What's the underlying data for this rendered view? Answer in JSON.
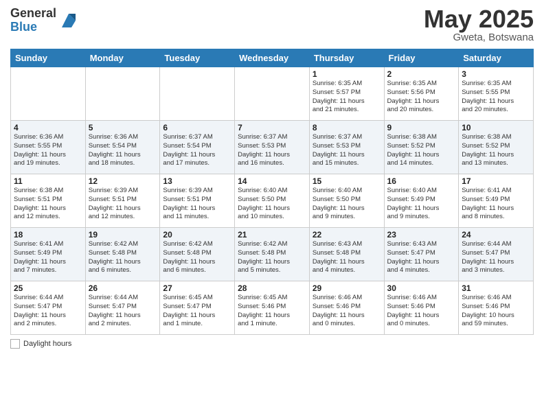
{
  "header": {
    "logo_general": "General",
    "logo_blue": "Blue",
    "month": "May 2025",
    "location": "Gweta, Botswana"
  },
  "weekdays": [
    "Sunday",
    "Monday",
    "Tuesday",
    "Wednesday",
    "Thursday",
    "Friday",
    "Saturday"
  ],
  "legend": {
    "daylight_label": "Daylight hours"
  },
  "weeks": [
    [
      {
        "day": "",
        "info": ""
      },
      {
        "day": "",
        "info": ""
      },
      {
        "day": "",
        "info": ""
      },
      {
        "day": "",
        "info": ""
      },
      {
        "day": "1",
        "info": "Sunrise: 6:35 AM\nSunset: 5:57 PM\nDaylight: 11 hours\nand 21 minutes."
      },
      {
        "day": "2",
        "info": "Sunrise: 6:35 AM\nSunset: 5:56 PM\nDaylight: 11 hours\nand 20 minutes."
      },
      {
        "day": "3",
        "info": "Sunrise: 6:35 AM\nSunset: 5:55 PM\nDaylight: 11 hours\nand 20 minutes."
      }
    ],
    [
      {
        "day": "4",
        "info": "Sunrise: 6:36 AM\nSunset: 5:55 PM\nDaylight: 11 hours\nand 19 minutes."
      },
      {
        "day": "5",
        "info": "Sunrise: 6:36 AM\nSunset: 5:54 PM\nDaylight: 11 hours\nand 18 minutes."
      },
      {
        "day": "6",
        "info": "Sunrise: 6:37 AM\nSunset: 5:54 PM\nDaylight: 11 hours\nand 17 minutes."
      },
      {
        "day": "7",
        "info": "Sunrise: 6:37 AM\nSunset: 5:53 PM\nDaylight: 11 hours\nand 16 minutes."
      },
      {
        "day": "8",
        "info": "Sunrise: 6:37 AM\nSunset: 5:53 PM\nDaylight: 11 hours\nand 15 minutes."
      },
      {
        "day": "9",
        "info": "Sunrise: 6:38 AM\nSunset: 5:52 PM\nDaylight: 11 hours\nand 14 minutes."
      },
      {
        "day": "10",
        "info": "Sunrise: 6:38 AM\nSunset: 5:52 PM\nDaylight: 11 hours\nand 13 minutes."
      }
    ],
    [
      {
        "day": "11",
        "info": "Sunrise: 6:38 AM\nSunset: 5:51 PM\nDaylight: 11 hours\nand 12 minutes."
      },
      {
        "day": "12",
        "info": "Sunrise: 6:39 AM\nSunset: 5:51 PM\nDaylight: 11 hours\nand 12 minutes."
      },
      {
        "day": "13",
        "info": "Sunrise: 6:39 AM\nSunset: 5:51 PM\nDaylight: 11 hours\nand 11 minutes."
      },
      {
        "day": "14",
        "info": "Sunrise: 6:40 AM\nSunset: 5:50 PM\nDaylight: 11 hours\nand 10 minutes."
      },
      {
        "day": "15",
        "info": "Sunrise: 6:40 AM\nSunset: 5:50 PM\nDaylight: 11 hours\nand 9 minutes."
      },
      {
        "day": "16",
        "info": "Sunrise: 6:40 AM\nSunset: 5:49 PM\nDaylight: 11 hours\nand 9 minutes."
      },
      {
        "day": "17",
        "info": "Sunrise: 6:41 AM\nSunset: 5:49 PM\nDaylight: 11 hours\nand 8 minutes."
      }
    ],
    [
      {
        "day": "18",
        "info": "Sunrise: 6:41 AM\nSunset: 5:49 PM\nDaylight: 11 hours\nand 7 minutes."
      },
      {
        "day": "19",
        "info": "Sunrise: 6:42 AM\nSunset: 5:48 PM\nDaylight: 11 hours\nand 6 minutes."
      },
      {
        "day": "20",
        "info": "Sunrise: 6:42 AM\nSunset: 5:48 PM\nDaylight: 11 hours\nand 6 minutes."
      },
      {
        "day": "21",
        "info": "Sunrise: 6:42 AM\nSunset: 5:48 PM\nDaylight: 11 hours\nand 5 minutes."
      },
      {
        "day": "22",
        "info": "Sunrise: 6:43 AM\nSunset: 5:48 PM\nDaylight: 11 hours\nand 4 minutes."
      },
      {
        "day": "23",
        "info": "Sunrise: 6:43 AM\nSunset: 5:47 PM\nDaylight: 11 hours\nand 4 minutes."
      },
      {
        "day": "24",
        "info": "Sunrise: 6:44 AM\nSunset: 5:47 PM\nDaylight: 11 hours\nand 3 minutes."
      }
    ],
    [
      {
        "day": "25",
        "info": "Sunrise: 6:44 AM\nSunset: 5:47 PM\nDaylight: 11 hours\nand 2 minutes."
      },
      {
        "day": "26",
        "info": "Sunrise: 6:44 AM\nSunset: 5:47 PM\nDaylight: 11 hours\nand 2 minutes."
      },
      {
        "day": "27",
        "info": "Sunrise: 6:45 AM\nSunset: 5:47 PM\nDaylight: 11 hours\nand 1 minute."
      },
      {
        "day": "28",
        "info": "Sunrise: 6:45 AM\nSunset: 5:46 PM\nDaylight: 11 hours\nand 1 minute."
      },
      {
        "day": "29",
        "info": "Sunrise: 6:46 AM\nSunset: 5:46 PM\nDaylight: 11 hours\nand 0 minutes."
      },
      {
        "day": "30",
        "info": "Sunrise: 6:46 AM\nSunset: 5:46 PM\nDaylight: 11 hours\nand 0 minutes."
      },
      {
        "day": "31",
        "info": "Sunrise: 6:46 AM\nSunset: 5:46 PM\nDaylight: 10 hours\nand 59 minutes."
      }
    ]
  ]
}
